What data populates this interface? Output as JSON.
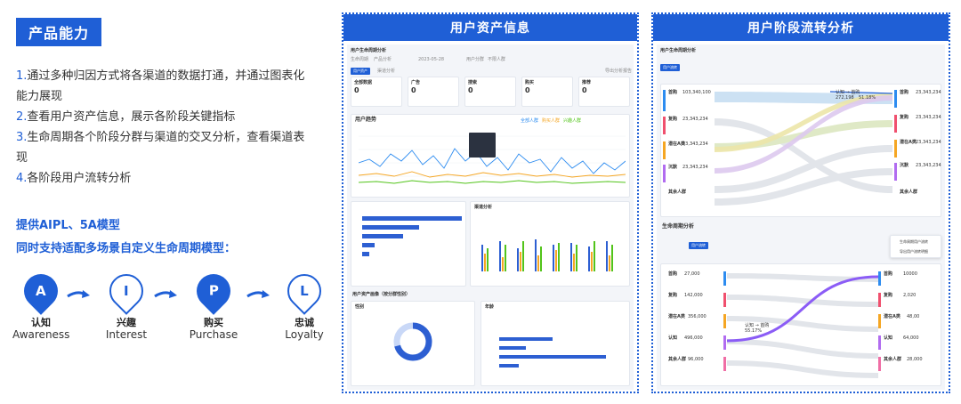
{
  "left": {
    "title": "产品能力",
    "points": [
      {
        "num": "1.",
        "text": "通过多种归因方式将各渠道的数据打通，并通过图表化能力展现"
      },
      {
        "num": "2.",
        "text": "查看用户资产信息，展示各阶段关键指标"
      },
      {
        "num": "3.",
        "text": "生命周期各个阶段分群与渠道的交叉分析，查看渠道表现"
      },
      {
        "num": "4.",
        "text": "各阶段用户流转分析"
      }
    ],
    "highlight1": "提供AIPL、5A模型",
    "highlight2": "同时支持适配多场景自定义生命周期模型：",
    "stages": [
      {
        "letter": "A",
        "cn": "认知",
        "en": "Awareness",
        "style": "filled"
      },
      {
        "letter": "I",
        "cn": "兴趣",
        "en": "Interest",
        "style": "outline"
      },
      {
        "letter": "P",
        "cn": "购买",
        "en": "Purchase",
        "style": "filled"
      },
      {
        "letter": "L",
        "cn": "忠诚",
        "en": "Loyalty",
        "style": "outline"
      }
    ]
  },
  "panel1": {
    "header": "用户资产信息",
    "page_title": "用户生命周期分析",
    "filters": [
      "生命周期",
      "产品分析",
      "2023-05-28",
      "用户分群",
      "不限人群"
    ],
    "tab_active": "用户资产",
    "tab_other": "渠道分析",
    "export_label": "导出分析报告",
    "kpis": [
      {
        "label": "全部数据",
        "value": "0"
      },
      {
        "label": "广告",
        "value": "0"
      },
      {
        "label": "搜索",
        "value": "0"
      },
      {
        "label": "购买",
        "value": "0"
      },
      {
        "label": "推荐",
        "value": "0"
      }
    ],
    "trend_title": "用户趋势",
    "trend_legend": [
      "全部人群",
      "购买人群",
      "兴趣人群"
    ],
    "dist_title": "渠道分析",
    "bottom_title": "用户资产画像（按分群性别）",
    "bottom_left_title": "性别",
    "bottom_right_title": "年龄"
  },
  "panel2": {
    "header": "用户阶段流转分析",
    "page_title": "用户生命周期分析",
    "tab_active": "用户流转",
    "left_nodes": [
      {
        "name": "首购",
        "value": "103,340,100"
      },
      {
        "name": "复购",
        "value": "23,343,234"
      },
      {
        "name": "潜在A类",
        "value": "23,343,234"
      },
      {
        "name": "沉默",
        "value": "23,343,234"
      },
      {
        "name": "其余人群",
        "value": ""
      }
    ],
    "right_nodes": [
      {
        "name": "首购",
        "value": "23,343,234"
      },
      {
        "name": "复购",
        "value": "23,343,234"
      },
      {
        "name": "潜在A类",
        "value": "23,343,234"
      },
      {
        "name": "沉默",
        "value": "23,343,234"
      },
      {
        "name": "其余人群",
        "value": ""
      }
    ],
    "tooltip": "认知 → 首购",
    "tooltip_value": "272,198",
    "tooltip_pct": "51.18%",
    "section2_title": "生命周期分析",
    "section2_tab": "用户流转",
    "popup_line1": "生命周期用户流转",
    "popup_line2": "导出用户流转明细",
    "left_nodes2": [
      {
        "name": "首购",
        "value": "27,000"
      },
      {
        "name": "复购",
        "value": "142,000"
      },
      {
        "name": "潜在A类",
        "value": "356,000"
      },
      {
        "name": "认知",
        "value": "496,000"
      },
      {
        "name": "其余人群",
        "value": "96,000"
      }
    ],
    "right_nodes2": [
      {
        "name": "首购",
        "value": "10000"
      },
      {
        "name": "复购",
        "value": "2,020"
      },
      {
        "name": "潜在A类",
        "value": "48,00"
      },
      {
        "name": "认知",
        "value": "64,000"
      },
      {
        "name": "其余人群",
        "value": "28,000"
      }
    ],
    "tooltip2": "认知 → 首购",
    "tooltip2_pct": "55.17%"
  },
  "colors": {
    "accent": "#1f5fd6",
    "series_blue": "#2d8cf0",
    "series_orange": "#f5a623",
    "series_green": "#52c41a",
    "flow_purple": "#8b5cf6"
  }
}
